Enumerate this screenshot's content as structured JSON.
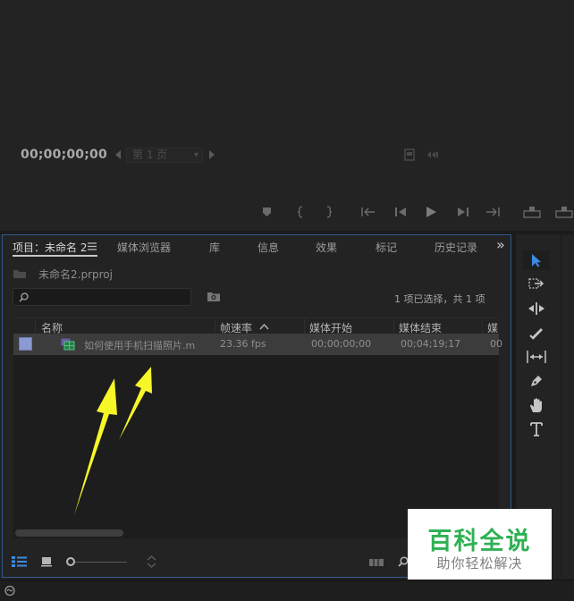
{
  "monitor": {
    "timecode": "00;00;00;00",
    "page_selector": "第 1 页"
  },
  "project_panel": {
    "tabs": [
      {
        "label": "项目：未命名 2",
        "active": true
      },
      {
        "label": "媒体浏览器",
        "active": false
      },
      {
        "label": "库",
        "active": false
      },
      {
        "label": "信息",
        "active": false
      },
      {
        "label": "效果",
        "active": false
      },
      {
        "label": "标记",
        "active": false
      },
      {
        "label": "历史记录",
        "active": false
      }
    ],
    "more_tabs": "»",
    "project_file": "未命名2.prproj",
    "search_placeholder": "",
    "selection_status": "1 项已选择，共 1 项",
    "columns": {
      "name": "名称",
      "frame_rate": "帧速率",
      "media_start": "媒体开始",
      "media_end": "媒体结束",
      "media_cut": "媒"
    },
    "rows": [
      {
        "label_color": "#8c9ad3",
        "name": "如何使用手机扫描照片.m",
        "frame_rate": "23.36 fps",
        "media_start": "00;00;00;00",
        "media_end": "00;04;19;17",
        "media_cut": "00"
      }
    ]
  },
  "watermark": {
    "title": "百科全说",
    "subtitle": "助你轻松解决"
  },
  "colors": {
    "accent": "#2f5a8c",
    "selection_tool": "#3b8be0",
    "annotation_arrow": "#f7f728",
    "watermark_green": "#2fb154"
  },
  "icons": [
    "selection-tool-icon",
    "track-select-icon",
    "ripple-edit-icon",
    "razor-icon",
    "slip-icon",
    "pen-icon",
    "hand-icon",
    "type-icon"
  ]
}
